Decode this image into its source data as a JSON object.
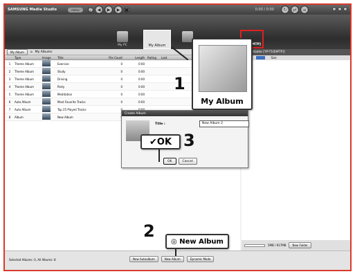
{
  "app": {
    "brand": "SAMSUNG Media Studio",
    "menu": "menu",
    "timer": "0:00 / 0:00"
  },
  "nav": [
    {
      "label": "My PC"
    },
    {
      "label": "My Album"
    },
    {
      "label": "T10 [MTP]"
    }
  ],
  "toolbar": {
    "view_btn": "My Album",
    "crumb": "My Albums"
  },
  "table": {
    "headers": [
      "",
      "Type",
      "Image",
      "Title",
      "File Count",
      "Length",
      "Rating",
      "Last"
    ],
    "rows": [
      {
        "n": "1",
        "type": "Theme Album",
        "title": "Exercise",
        "count": "0",
        "len": "0:00"
      },
      {
        "n": "2",
        "type": "Theme Album",
        "title": "Study",
        "count": "0",
        "len": "0:00"
      },
      {
        "n": "3",
        "type": "Theme Album",
        "title": "Driving",
        "count": "0",
        "len": "0:00"
      },
      {
        "n": "4",
        "type": "Theme Album",
        "title": "Party",
        "count": "0",
        "len": "0:00"
      },
      {
        "n": "5",
        "type": "Theme Album",
        "title": "Meditation",
        "count": "0",
        "len": "0:00"
      },
      {
        "n": "6",
        "type": "Auto Album",
        "title": "Most Favorite Tracks",
        "count": "0",
        "len": "0:00"
      },
      {
        "n": "7",
        "type": "Auto Album",
        "title": "Top 25 Played Tracks",
        "count": "0",
        "len": "0:00"
      },
      {
        "n": "8",
        "type": "Album",
        "title": "New Album",
        "count": "0",
        "len": "0:00"
      }
    ]
  },
  "right_panel": {
    "title": "Portable [YP-T10[MTP]]",
    "col_type": "Type",
    "col_size": "Size",
    "storage": "5MB / 917MB",
    "new_folder": "New Folder"
  },
  "dialog": {
    "title": "Create Album",
    "label": "Title :",
    "value": "New Album 2",
    "ok": "OK",
    "cancel": "Cancel"
  },
  "bottom": {
    "status": "Selected Albums: 0, All Albums: 8",
    "btn_auto": "New Autoalbum",
    "btn_new": "New Album",
    "btn_dynamic": "Dynamic Mode"
  },
  "callouts": {
    "album": "My Album",
    "ok": "OK",
    "new": "New Album",
    "num1": "1",
    "num2": "2",
    "num3": "3"
  }
}
